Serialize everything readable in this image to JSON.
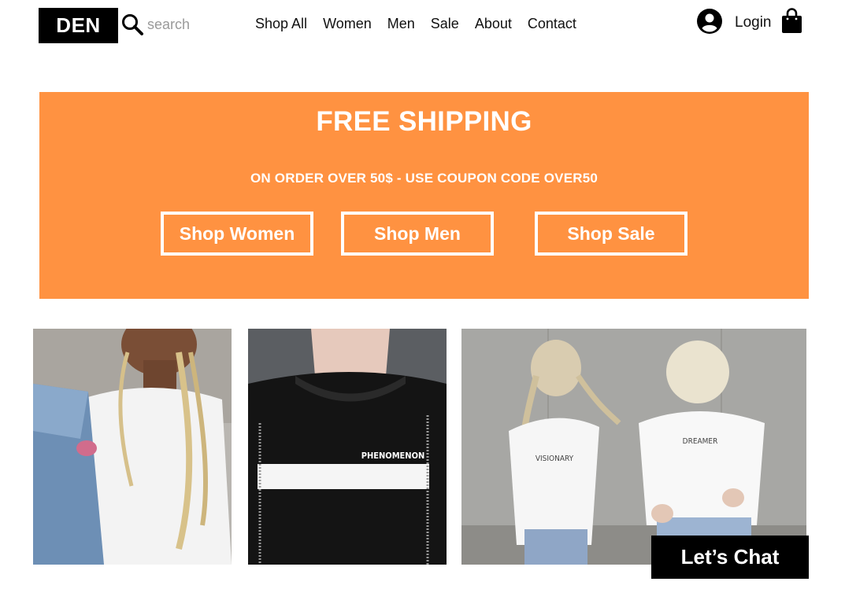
{
  "header": {
    "logo_text": "DEN",
    "search": {
      "placeholder": "search",
      "value": ""
    },
    "nav": [
      "Shop All",
      "Women",
      "Men",
      "Sale",
      "About",
      "Contact"
    ],
    "account_icon": "account-circle-icon",
    "login_label": "Login",
    "cart_icon": "shopping-bag-icon"
  },
  "banner": {
    "title": "FREE SHIPPING",
    "subtitle": "ON ORDER OVER 50$ - USE COUPON CODE OVER50",
    "buttons": [
      "Shop Women",
      "Shop Men",
      "Shop Sale"
    ],
    "background_color": "#ff9241"
  },
  "products": [
    {
      "image": "woman-denim-jacket-white-tee-photo"
    },
    {
      "image": "man-black-tee-phenomenon-photo",
      "shirt_text": "PHENOMENON"
    },
    {
      "image": "couple-white-tees-photo",
      "shirt_text_left": "VISIONARY",
      "shirt_text_right": "DREAMER"
    }
  ],
  "chat": {
    "label": "Let’s Chat"
  }
}
